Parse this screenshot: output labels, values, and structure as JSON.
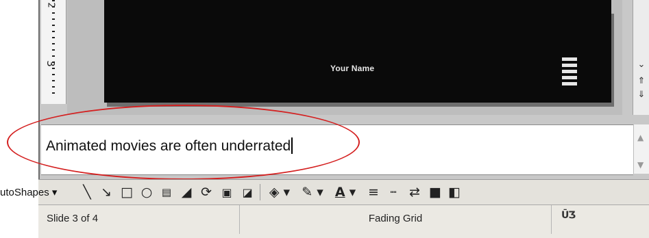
{
  "slide": {
    "name_text": "Your Name"
  },
  "ruler": {
    "number": "3",
    "number_top": "2"
  },
  "notes": {
    "text": "Animated movies are often underrated"
  },
  "toolbar": {
    "autoshapes_label": "utoShapes ▾",
    "icons": [
      "line-icon",
      "arrow-icon",
      "rectangle-icon",
      "oval-icon",
      "text-box-icon",
      "wordart-icon",
      "diagram-icon",
      "clip-art-icon",
      "picture-icon",
      "fill-color-icon",
      "line-color-icon",
      "font-color-icon",
      "line-style-icon",
      "dash-style-icon",
      "arrow-style-icon",
      "shadow-icon",
      "3d-style-icon"
    ]
  },
  "status": {
    "slide_position": "Slide 3 of 4",
    "design_template": "Fading Grid",
    "spell_label": "ŪƷ"
  },
  "colors": {
    "highlight": "#d42020",
    "slide_background": "#0a0a0a"
  }
}
